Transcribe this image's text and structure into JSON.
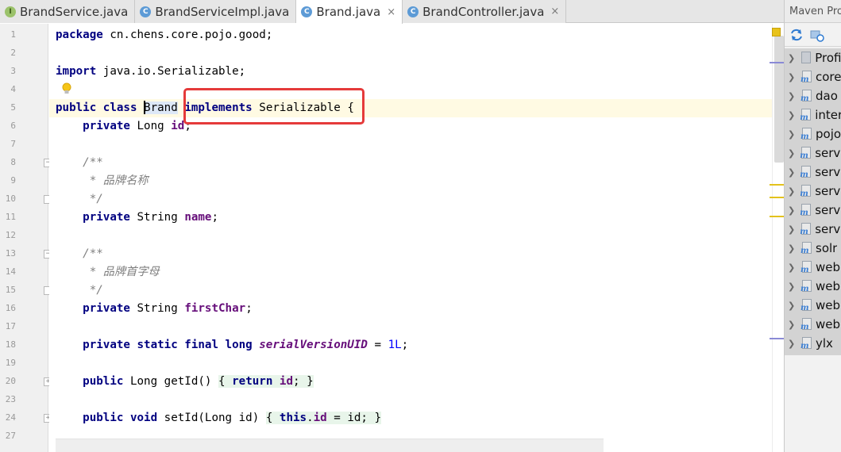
{
  "tabs": [
    {
      "icon": "I",
      "kind": "interface",
      "label": "BrandService.java",
      "active": false,
      "close": ""
    },
    {
      "icon": "C",
      "kind": "class",
      "label": "BrandServiceImpl.java",
      "active": false,
      "close": ""
    },
    {
      "icon": "C",
      "kind": "class",
      "label": "Brand.java",
      "active": true,
      "close": "×"
    },
    {
      "icon": "C",
      "kind": "class",
      "label": "BrandController.java",
      "active": false,
      "close": "×"
    }
  ],
  "gutter": {
    "line_numbers": [
      "1",
      "2",
      "3",
      "4",
      "5",
      "6",
      "7",
      "8",
      "9",
      "10",
      "11",
      "12",
      "13",
      "14",
      "15",
      "16",
      "17",
      "18",
      "19",
      "20",
      "23",
      "24",
      "27"
    ]
  },
  "code": {
    "l1": {
      "kw": "package",
      "text": " cn.chens.core.pojo.good;"
    },
    "l3": {
      "kw": "import",
      "text": " java.io.Serializable;"
    },
    "l5": {
      "kw": "public class",
      "name": "Brand",
      "kw2": "implements",
      "text": " Serializable {"
    },
    "l6": {
      "kw": "private",
      "type": " Long ",
      "field": "id",
      "end": ";"
    },
    "l8": {
      "text": "/**"
    },
    "l9": {
      "text": " * 品牌名称"
    },
    "l10": {
      "text": " */"
    },
    "l11": {
      "kw": "private",
      "type": " String ",
      "field": "name",
      "end": ";"
    },
    "l13": {
      "text": "/**"
    },
    "l14": {
      "text": " * 品牌首字母"
    },
    "l15": {
      "text": " */"
    },
    "l16": {
      "kw": "private",
      "type": " String ",
      "field": "firstChar",
      "end": ";"
    },
    "l18": {
      "kw": "private static final long",
      "field": "serialVersionUID",
      "eq": " = ",
      "num": "1L",
      "end": ";"
    },
    "l20": {
      "kw": "public",
      "type": " Long getId() ",
      "ob": "{",
      "kw2": "return",
      "field": "id",
      "semi": ";",
      "cb": "}"
    },
    "l23": {
      "kw": "public void",
      "type": " setId(Long id) ",
      "ob": "{",
      "kw2": "this",
      "dot": ".",
      "field": "id",
      "rest": " = id;",
      "cb": "}"
    }
  },
  "maven": {
    "title": "Maven Projects",
    "items": [
      {
        "label": "Profiles",
        "icon": "folder"
      },
      {
        "label": "core",
        "icon": "maven"
      },
      {
        "label": "dao",
        "icon": "maven"
      },
      {
        "label": "interface",
        "icon": "maven"
      },
      {
        "label": "pojo",
        "icon": "maven"
      },
      {
        "label": "service",
        "icon": "maven"
      },
      {
        "label": "service",
        "icon": "maven"
      },
      {
        "label": "service",
        "icon": "maven"
      },
      {
        "label": "service",
        "icon": "maven"
      },
      {
        "label": "service",
        "icon": "maven"
      },
      {
        "label": "solr",
        "icon": "maven"
      },
      {
        "label": "web",
        "icon": "maven"
      },
      {
        "label": "web",
        "icon": "maven"
      },
      {
        "label": "web",
        "icon": "maven"
      },
      {
        "label": "web",
        "icon": "maven"
      },
      {
        "label": "ylx",
        "icon": "maven"
      }
    ]
  },
  "colors": {
    "accent": "#e53a3a",
    "keyword": "#000080",
    "field": "#660e7a",
    "comment": "#808080"
  }
}
